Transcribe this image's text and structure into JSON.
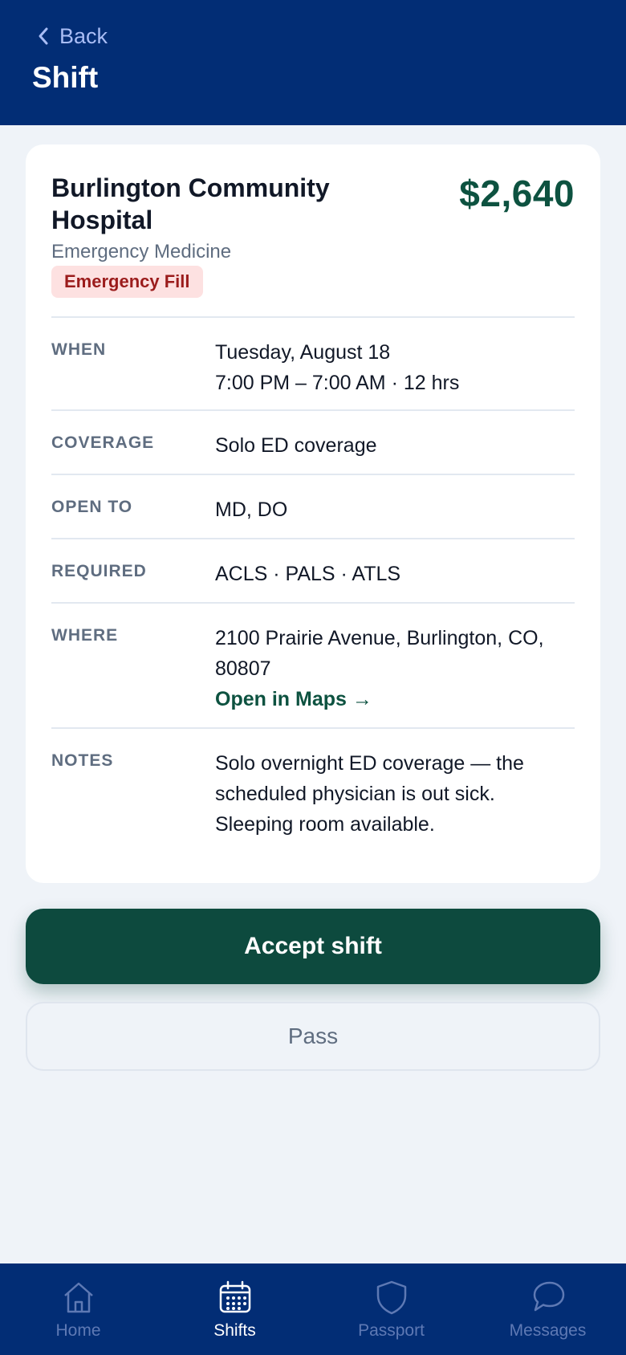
{
  "header": {
    "back_label": "Back",
    "title": "Shift"
  },
  "shift": {
    "facility": "Burlington Community Hospital",
    "price": "$2,640",
    "specialty": "Emergency Medicine",
    "badge": "Emergency Fill",
    "details": [
      {
        "label": "WHEN",
        "lines": [
          "Tuesday, August 18",
          "7:00 PM – 7:00 AM · 12 hrs"
        ]
      },
      {
        "label": "COVERAGE",
        "value": "Solo ED coverage"
      },
      {
        "label": "OPEN TO",
        "value": "MD, DO"
      },
      {
        "label": "REQUIRED",
        "value": "ACLS · PALS · ATLS"
      },
      {
        "label": "WHERE",
        "value": "2100 Prairie Avenue, Burlington, CO, 80807",
        "link": "Open in Maps →"
      },
      {
        "label": "NOTES",
        "value": "Solo overnight ED coverage — the scheduled physician is out sick. Sleeping room available."
      }
    ]
  },
  "actions": {
    "accept": "Accept shift",
    "pass": "Pass"
  },
  "tabbar": {
    "items": [
      {
        "label": "Home",
        "icon": "home-icon",
        "active": false
      },
      {
        "label": "Shifts",
        "icon": "calendar-icon",
        "active": true
      },
      {
        "label": "Passport",
        "icon": "shield-icon",
        "active": false
      },
      {
        "label": "Messages",
        "icon": "chat-bubble-icon",
        "active": false
      }
    ]
  },
  "colors": {
    "header_bg": "#022d75",
    "accent_green": "#0d4a3e",
    "price_green": "#0d5240",
    "badge_bg": "#fde1e1",
    "badge_text": "#9b1c1c"
  }
}
